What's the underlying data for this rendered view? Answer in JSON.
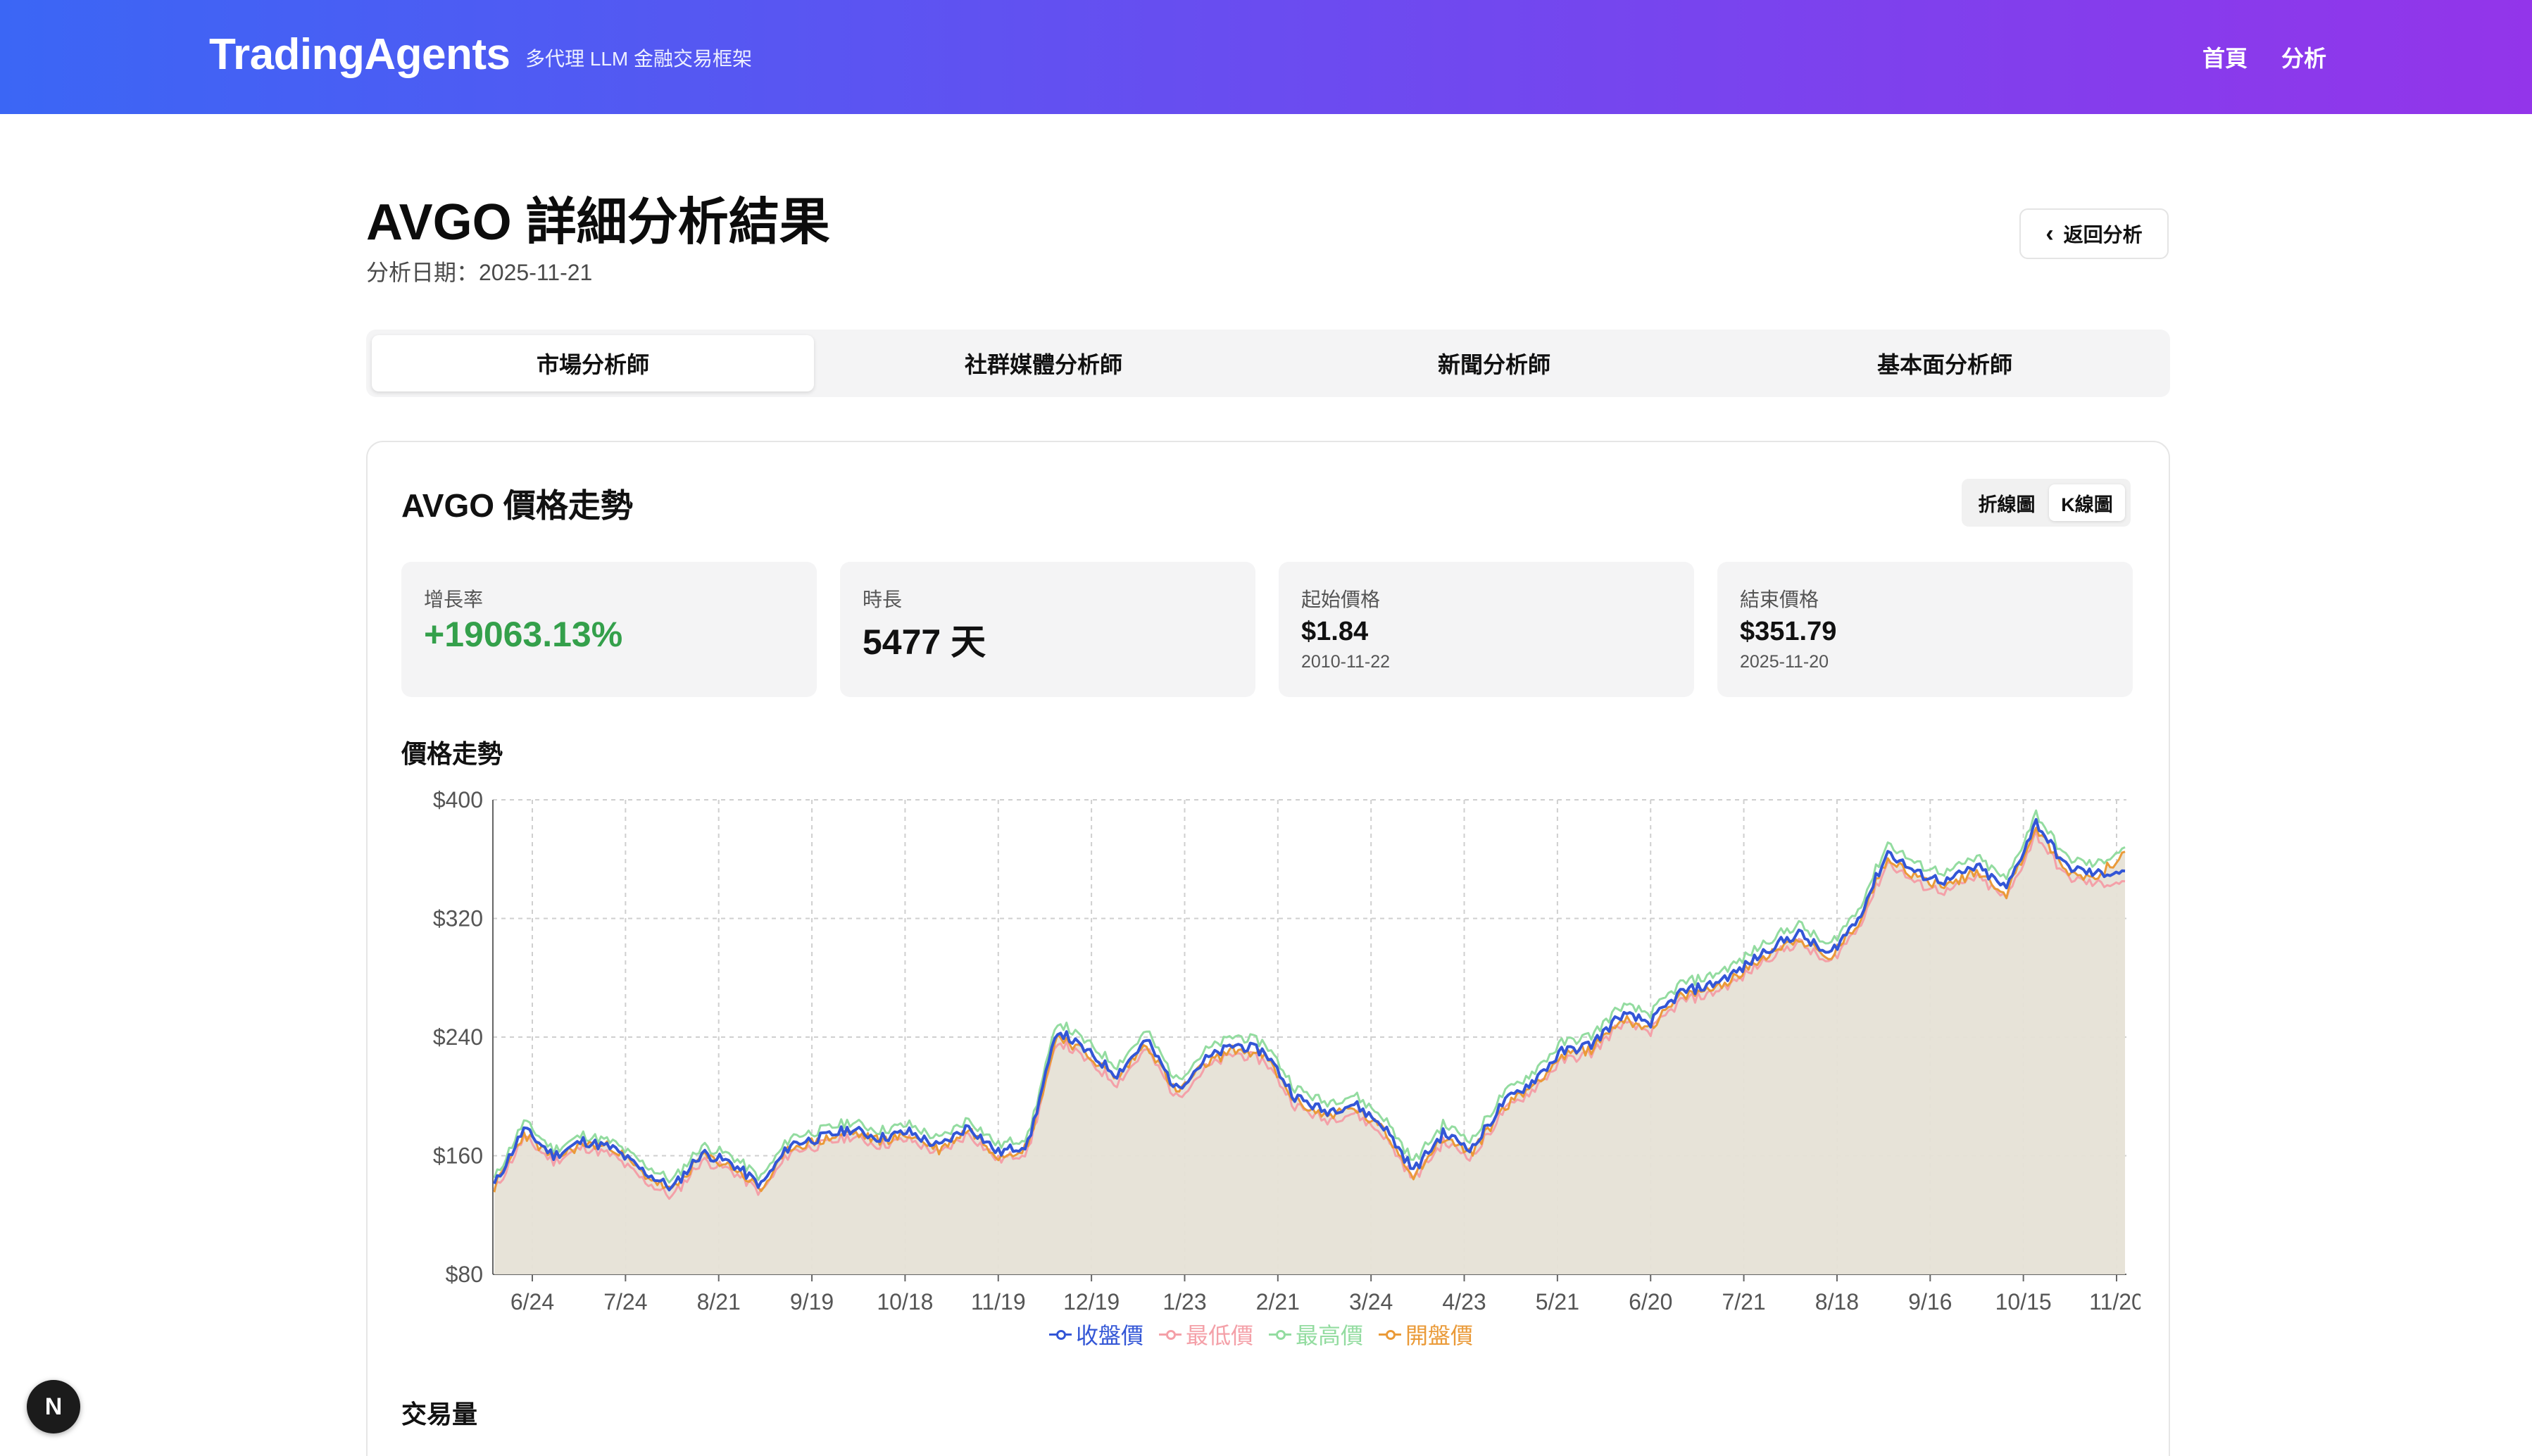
{
  "header": {
    "brand": "TradingAgents",
    "subtitle": "多代理 LLM 金融交易框架",
    "nav": [
      "首頁",
      "分析"
    ]
  },
  "page": {
    "title": "AVGO 詳細分析結果",
    "date": "分析日期：2025-11-21",
    "back_label": "返回分析"
  },
  "tabs": [
    "市場分析師",
    "社群媒體分析師",
    "新聞分析師",
    "基本面分析師"
  ],
  "active_tab": 0,
  "card": {
    "title": "AVGO 價格走勢",
    "toggle": [
      "折線圖",
      "K線圖"
    ],
    "active_toggle": 1,
    "stats": [
      {
        "label": "增長率",
        "value": "+19063.13%",
        "sub": ""
      },
      {
        "label": "時長",
        "value": "5477 天",
        "sub": ""
      },
      {
        "label": "起始價格",
        "value": "$1.84",
        "sub": "2010-11-22"
      },
      {
        "label": "結束價格",
        "value": "$351.79",
        "sub": "2025-11-20"
      }
    ],
    "price_section_title": "價格走勢",
    "volume_section_title": "交易量"
  },
  "colors": {
    "close": "#3356d6",
    "low": "#f4a0a8",
    "high": "#93dca0",
    "open": "#ea9a38",
    "area": "#e6e1d6",
    "growth": "#34a04b"
  },
  "chart_data": {
    "type": "line",
    "title": "價格走勢",
    "xlabel": "",
    "ylabel": "",
    "ylim": [
      80,
      400
    ],
    "yticks": [
      "$400",
      "$320",
      "$240",
      "$160",
      "$80"
    ],
    "xticks": [
      "6/24",
      "7/24",
      "8/21",
      "9/19",
      "10/18",
      "11/19",
      "12/19",
      "1/23",
      "2/21",
      "3/24",
      "4/23",
      "5/21",
      "6/20",
      "7/21",
      "8/18",
      "9/16",
      "10/15",
      "11/20"
    ],
    "grid": true,
    "legend_position": "bottom",
    "series": [
      {
        "name": "收盤價",
        "values": [
          140,
          178,
          160,
          170,
          165,
          150,
          138,
          162,
          155,
          140,
          168,
          172,
          178,
          172,
          176,
          166,
          180,
          162,
          168,
          245,
          230,
          215,
          238,
          205,
          225,
          235,
          230,
          200,
          190,
          195,
          180,
          150,
          175,
          165,
          195,
          210,
          230,
          235,
          255,
          250,
          270,
          275,
          285,
          300,
          310,
          295,
          320,
          365,
          350,
          345,
          355,
          340,
          385,
          355,
          350,
          352
        ]
      },
      {
        "name": "最低價",
        "values": [
          136,
          172,
          156,
          166,
          160,
          144,
          132,
          157,
          150,
          135,
          163,
          167,
          173,
          167,
          171,
          161,
          175,
          157,
          163,
          238,
          224,
          209,
          232,
          199,
          219,
          229,
          224,
          194,
          184,
          189,
          174,
          144,
          169,
          159,
          189,
          204,
          224,
          229,
          249,
          244,
          264,
          269,
          279,
          294,
          304,
          289,
          314,
          358,
          343,
          338,
          348,
          333,
          377,
          348,
          343,
          345
        ]
      },
      {
        "name": "最高價",
        "values": [
          144,
          183,
          164,
          174,
          169,
          155,
          143,
          167,
          160,
          145,
          173,
          177,
          183,
          177,
          181,
          171,
          185,
          167,
          173,
          251,
          236,
          221,
          244,
          211,
          231,
          241,
          236,
          206,
          196,
          201,
          186,
          156,
          181,
          171,
          201,
          216,
          236,
          241,
          261,
          256,
          276,
          281,
          291,
          306,
          316,
          301,
          326,
          371,
          356,
          351,
          361,
          346,
          391,
          361,
          356,
          368
        ]
      },
      {
        "name": "開盤價",
        "values": [
          138,
          175,
          158,
          168,
          166,
          148,
          136,
          160,
          153,
          137,
          166,
          170,
          176,
          170,
          174,
          164,
          178,
          160,
          166,
          242,
          228,
          212,
          236,
          202,
          222,
          232,
          227,
          197,
          187,
          192,
          177,
          147,
          172,
          162,
          192,
          207,
          227,
          232,
          252,
          247,
          267,
          272,
          282,
          297,
          307,
          292,
          317,
          362,
          347,
          342,
          352,
          337,
          381,
          352,
          347,
          365
        ]
      }
    ]
  },
  "badge": "N"
}
